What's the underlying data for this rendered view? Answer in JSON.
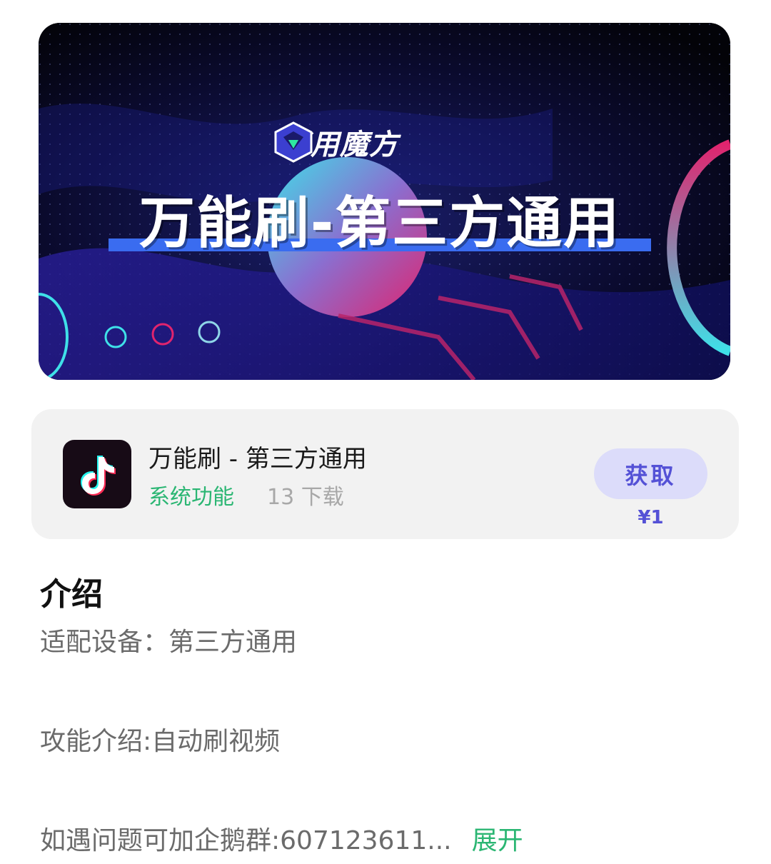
{
  "banner": {
    "brand_name": "好用魔方",
    "headline": "万能刷-第三方通用"
  },
  "app": {
    "title": "万能刷 - 第三方通用",
    "category": "系统功能",
    "downloads": "13 下载",
    "get_label": "获取",
    "price": "¥1",
    "icon": "tiktok-icon"
  },
  "intro": {
    "heading": "介绍",
    "lines": [
      "适配设备：第三方通用",
      "攻能介绍:自动刷视频",
      "如遇问题可加企鹅群:607123611..."
    ],
    "expand_label": "展开"
  },
  "colors": {
    "accent_green": "#2bb673",
    "button_bg": "#dcdcfa",
    "button_text": "#5451d6",
    "headline_bar": "#3a6cf0"
  }
}
